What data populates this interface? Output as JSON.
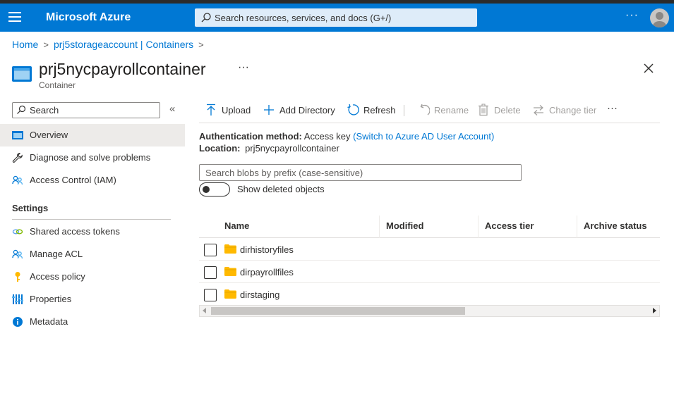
{
  "topbar": {
    "brand": "Microsoft Azure",
    "search_placeholder": "Search resources, services, and docs (G+/)",
    "more": "···"
  },
  "breadcrumb": {
    "items": [
      "Home",
      "prj5storageaccount | Containers"
    ],
    "separator": ">"
  },
  "header": {
    "title": "prj5nycpayrollcontainer",
    "subtitle": "Container",
    "more": "···"
  },
  "sidebar": {
    "search_placeholder": "Search",
    "collapse": "«",
    "items": [
      {
        "label": "Overview",
        "icon": "container-icon",
        "active": true
      },
      {
        "label": "Diagnose and solve problems",
        "icon": "wrench-icon"
      },
      {
        "label": "Access Control (IAM)",
        "icon": "people-icon"
      }
    ],
    "settings_header": "Settings",
    "settings_items": [
      {
        "label": "Shared access tokens",
        "icon": "link-icon"
      },
      {
        "label": "Manage ACL",
        "icon": "people-icon"
      },
      {
        "label": "Access policy",
        "icon": "key-icon"
      },
      {
        "label": "Properties",
        "icon": "properties-icon"
      },
      {
        "label": "Metadata",
        "icon": "info-icon"
      }
    ]
  },
  "toolbar": {
    "upload": "Upload",
    "add_directory": "Add Directory",
    "refresh": "Refresh",
    "rename": "Rename",
    "delete": "Delete",
    "change_tier": "Change tier",
    "more": "···"
  },
  "info": {
    "auth_label": "Authentication method:",
    "auth_value": "Access key",
    "auth_link": "(Switch to Azure AD User Account)",
    "location_label": "Location:",
    "location_value": "prj5nycpayrollcontainer"
  },
  "blob_search_placeholder": "Search blobs by prefix (case-sensitive)",
  "show_deleted_label": "Show deleted objects",
  "show_deleted_on": false,
  "table": {
    "columns": [
      "Name",
      "Modified",
      "Access tier",
      "Archive status"
    ],
    "rows": [
      {
        "name": "dirhistoryfiles"
      },
      {
        "name": "dirpayrollfiles"
      },
      {
        "name": "dirstaging"
      }
    ]
  },
  "colors": {
    "accent": "#0078d4",
    "folder": "#ffb900"
  }
}
